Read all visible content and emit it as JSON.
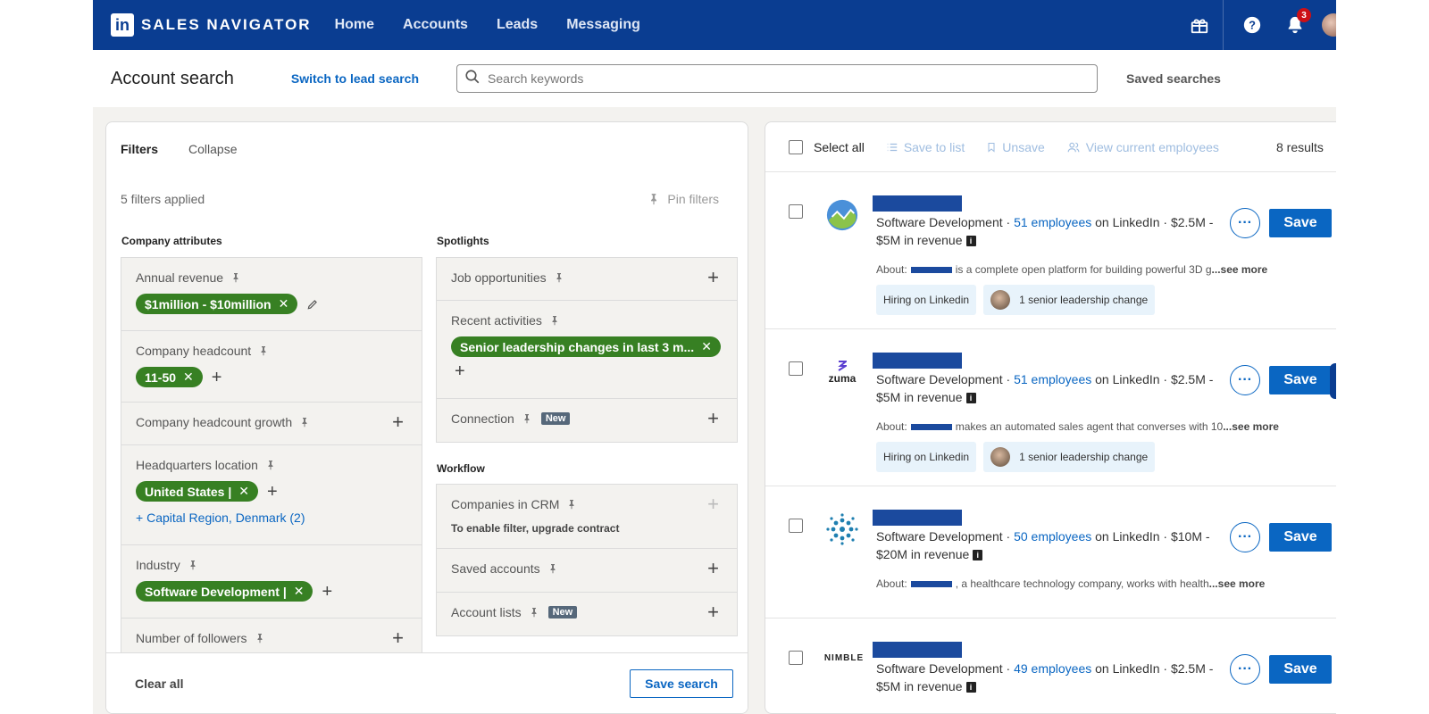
{
  "nav": {
    "brand_logo": "in",
    "brand": "SALES NAVIGATOR",
    "links": [
      "Home",
      "Accounts",
      "Leads",
      "Messaging"
    ],
    "notification_count": "3"
  },
  "header": {
    "title": "Account search",
    "switch_link": "Switch to lead search",
    "search_placeholder": "Search keywords",
    "saved_searches": "Saved searches"
  },
  "filters": {
    "tabs": [
      "Filters",
      "Collapse"
    ],
    "applied": "5 filters applied",
    "pin_filters": "Pin filters",
    "company_attributes": {
      "heading": "Company attributes",
      "annual_revenue": {
        "label": "Annual revenue",
        "chip": "$1million - $10million"
      },
      "headcount": {
        "label": "Company headcount",
        "chip": "11-50"
      },
      "headcount_growth": {
        "label": "Company headcount growth"
      },
      "hq_location": {
        "label": "Headquarters location",
        "chip": "United States |",
        "region": "Capital Region, Denmark (2)"
      },
      "industry": {
        "label": "Industry",
        "chip": "Software Development |"
      },
      "followers": {
        "label": "Number of followers"
      }
    },
    "spotlights": {
      "heading": "Spotlights",
      "job_opportunities": {
        "label": "Job opportunities"
      },
      "recent_activities": {
        "label": "Recent activities",
        "chip": "Senior leadership changes in last 3 m..."
      },
      "connection": {
        "label": "Connection",
        "badge": "New"
      }
    },
    "workflow": {
      "heading": "Workflow",
      "companies_crm": {
        "label": "Companies in CRM",
        "sub": "To enable filter, upgrade contract"
      },
      "saved_accounts": {
        "label": "Saved accounts"
      },
      "account_lists": {
        "label": "Account lists",
        "badge": "New"
      }
    },
    "footer": {
      "clear_all": "Clear all",
      "save_search": "Save search"
    }
  },
  "results": {
    "toolbar": {
      "select_all": "Select all",
      "save_to_list": "Save to list",
      "unsave": "Unsave",
      "view_employees": "View current employees",
      "count": "8 results"
    },
    "rows": [
      {
        "industry": "Software Development · ",
        "employees": "51 employees",
        "revenue_line1": " on LinkedIn · $2.5M -",
        "revenue_line2": "$5M in revenue",
        "about_prefix": "About:",
        "about_text": "is a complete open platform for building powerful 3D g",
        "see_more": "...see more",
        "tag1": "Hiring on Linkedin",
        "tag2": "1 senior leadership change"
      },
      {
        "logo_text": "zuma",
        "industry": "Software Development · ",
        "employees": "51 employees",
        "revenue_line1": " on LinkedIn · $2.5M -",
        "revenue_line2": "$5M in revenue",
        "about_prefix": "About:",
        "about_text": "makes an automated sales agent that converses with 10",
        "see_more": "...see more",
        "tag1": "Hiring on Linkedin",
        "tag2": "1 senior leadership change"
      },
      {
        "industry": "Software Development · ",
        "employees": "50 employees",
        "revenue_line1": " on LinkedIn · $10M -",
        "revenue_line2": "$20M in revenue",
        "about_prefix": "About:",
        "about_text": ", a healthcare technology company, works with health",
        "see_more": "...see more"
      },
      {
        "logo_text": "NIMBLE",
        "industry": "Software Development · ",
        "employees": "49 employees",
        "revenue_line1": " on LinkedIn · $2.5M -",
        "revenue_line2": "$5M in revenue"
      }
    ],
    "more_label": "···",
    "save_label": "Save",
    "info_glyph": "i"
  },
  "colors": {
    "nav_bg": "#0a3d91",
    "chip_green": "#378023",
    "link_blue": "#0a66c2"
  }
}
